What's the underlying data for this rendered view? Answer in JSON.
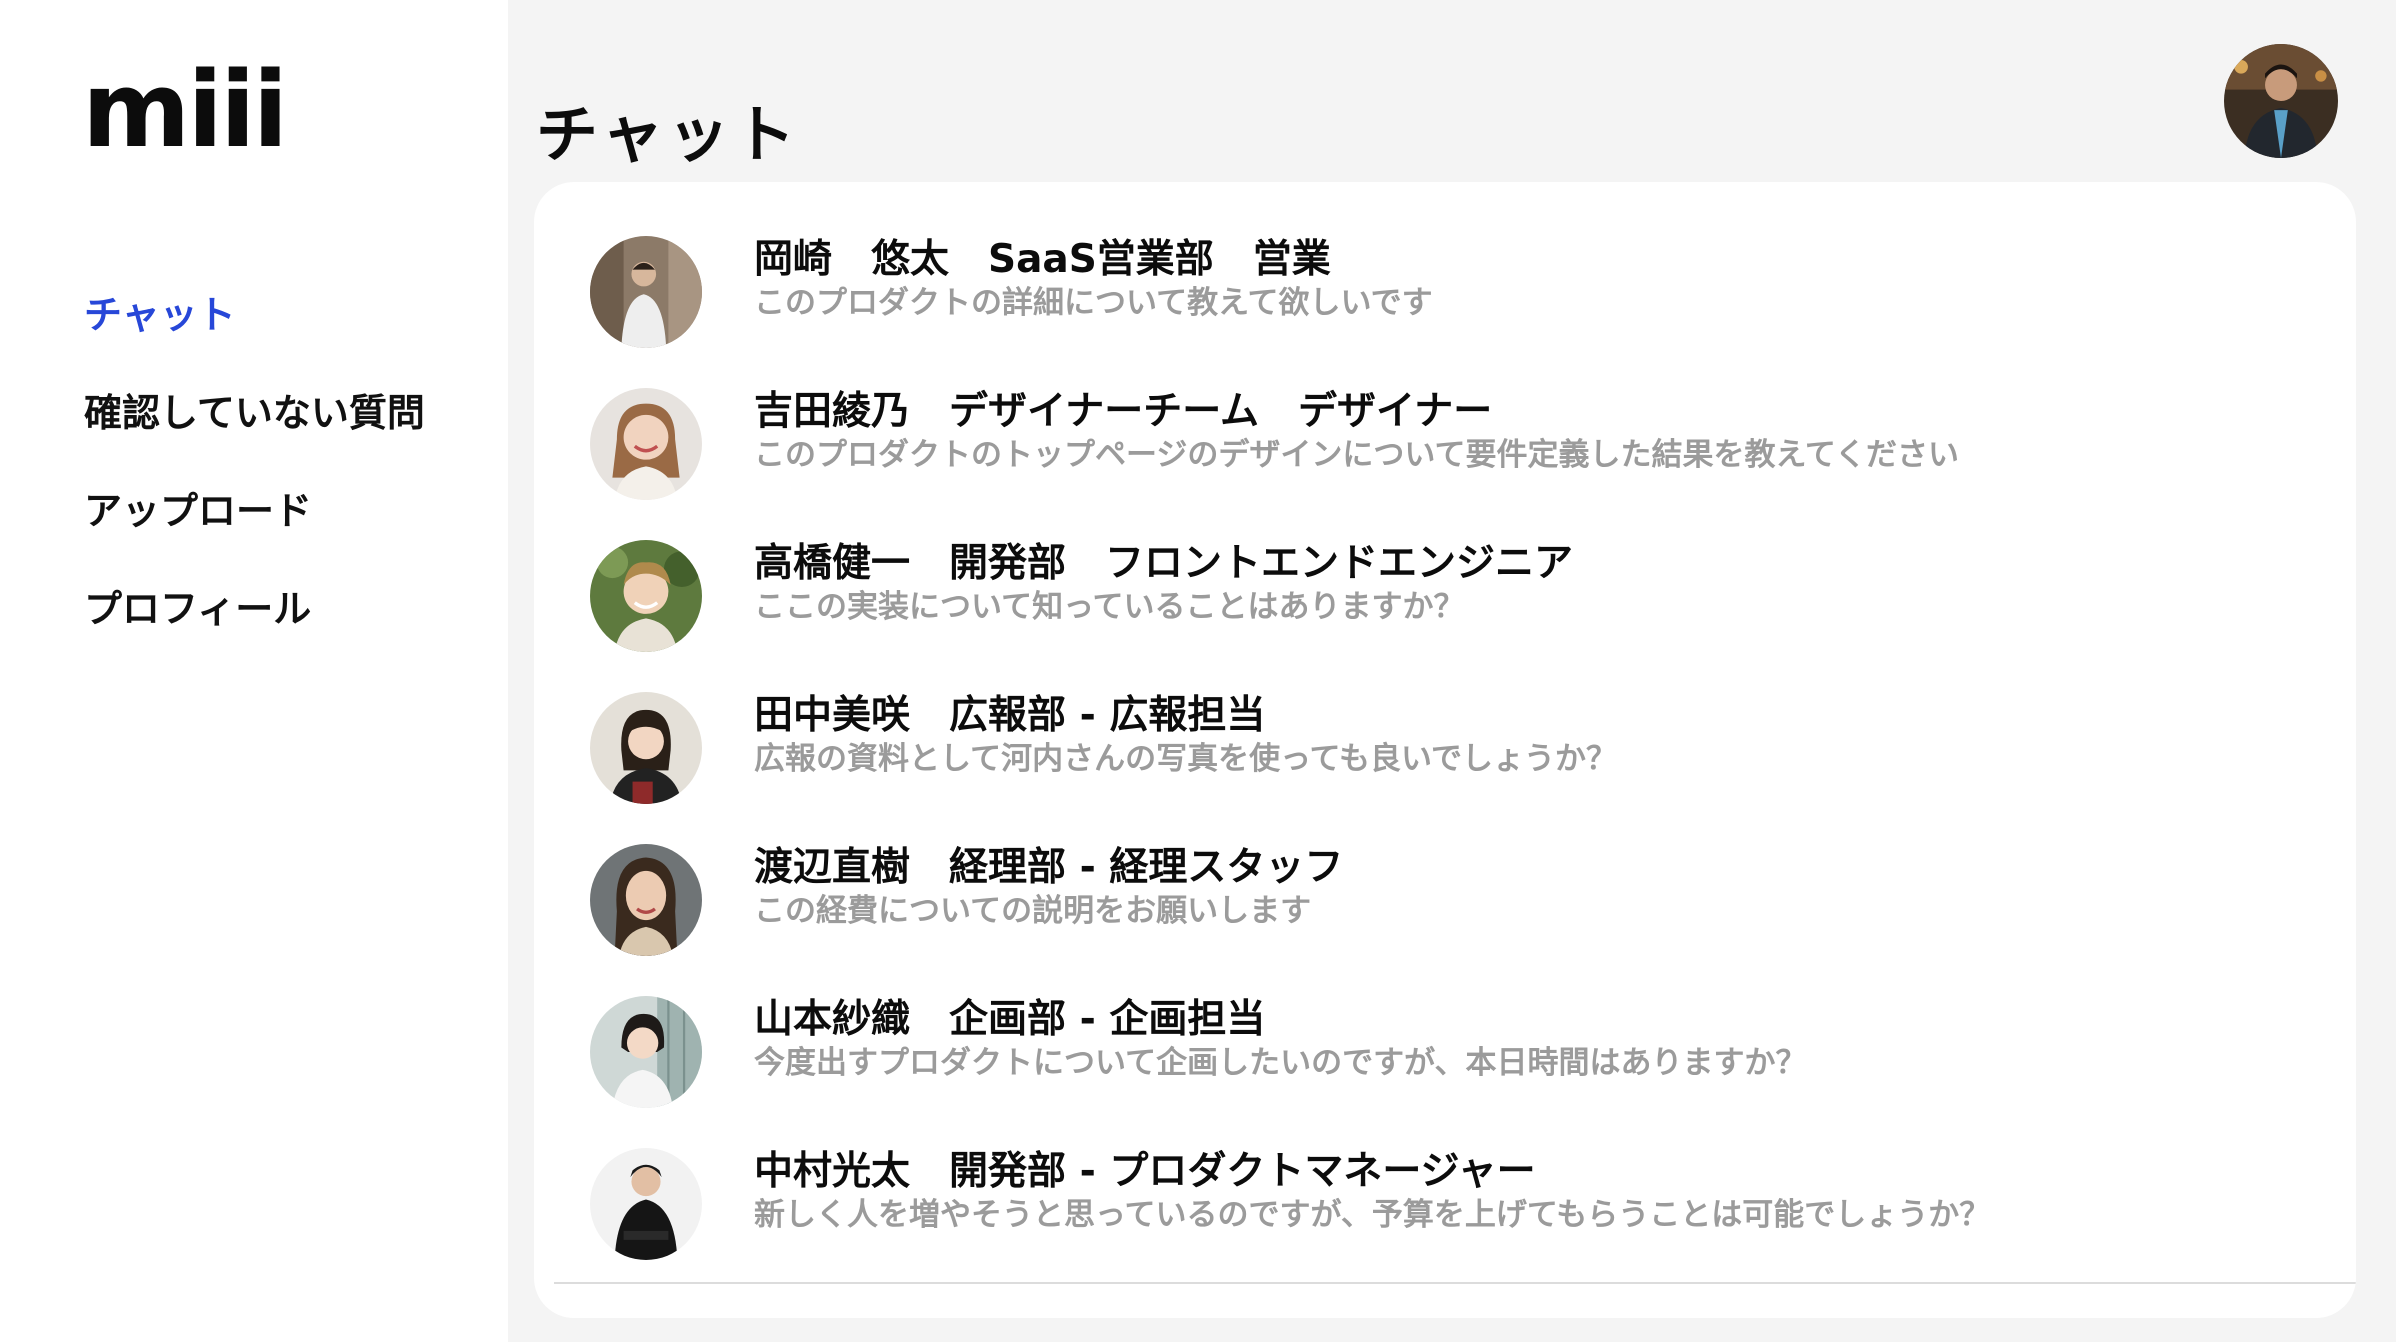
{
  "app": {
    "logo": "miii"
  },
  "sidebar": {
    "items": [
      {
        "label": "チャット",
        "active": true
      },
      {
        "label": "確認していない質問",
        "active": false
      },
      {
        "label": "アップロード",
        "active": false
      },
      {
        "label": "プロフィール",
        "active": false
      }
    ]
  },
  "header": {
    "title": "チャット",
    "user_avatar": "user-avatar-photo"
  },
  "chats": [
    {
      "name": "岡崎　悠太　SaaS営業部　営業",
      "message": "このプロダクトの詳細について教えて欲しいです"
    },
    {
      "name": "吉田綾乃　デザイナーチーム　デザイナー",
      "message": "このプロダクトのトップページのデザインについて要件定義した結果を教えてください"
    },
    {
      "name": "高橋健一　開発部　フロントエンドエンジニア",
      "message": "ここの実装について知っていることはありますか？"
    },
    {
      "name": "田中美咲　広報部 - 広報担当",
      "message": "広報の資料として河内さんの写真を使っても良いでしょうか？"
    },
    {
      "name": "渡辺直樹　経理部 - 経理スタッフ",
      "message": "この経費についての説明をお願いします"
    },
    {
      "name": "山本紗織　企画部 - 企画担当",
      "message": "今度出すプロダクトについて企画したいのですが、本日時間はありますか？"
    },
    {
      "name": "中村光太　開発部 - プロダクトマネージャー",
      "message": "新しく人を増やそうと思っているのですが、予算を上げてもらうことは可能でしょうか？"
    }
  ],
  "colors": {
    "accent": "#2747d8",
    "background": "#f4f4f4",
    "panel": "#ffffff",
    "muted_text": "#9b9b9b"
  }
}
